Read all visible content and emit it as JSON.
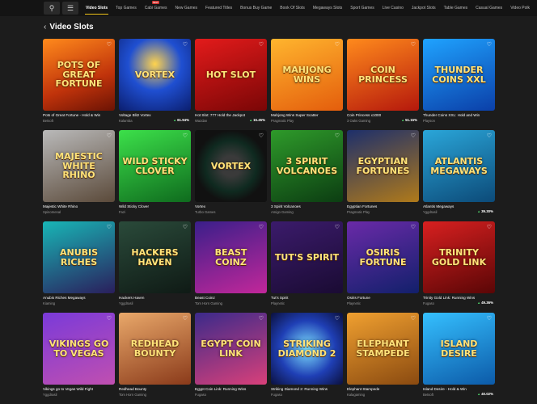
{
  "topbar": {
    "search_icon": "search-icon",
    "filter_icon": "filter-icon",
    "tabs": [
      {
        "label": "Video Slots",
        "active": true
      },
      {
        "label": "Top Games"
      },
      {
        "label": "Cabi Games",
        "badge": "NEW"
      },
      {
        "label": "New Games"
      },
      {
        "label": "Featured Titles"
      },
      {
        "label": "Bonus Buy Game"
      },
      {
        "label": "Book Of Slots"
      },
      {
        "label": "Megaways Slots"
      },
      {
        "label": "Sport Games"
      },
      {
        "label": "Live Casino"
      },
      {
        "label": "Jackpot Slots"
      },
      {
        "label": "Table Games"
      },
      {
        "label": "Casual Games"
      },
      {
        "label": "Video Polk"
      }
    ]
  },
  "header": {
    "back_icon": "chevron-left-icon",
    "title": "Video Slots"
  },
  "colors": {
    "page_bg": "#1c1c1c",
    "topbar_bg": "#141414",
    "accent": "#f0c419",
    "rtp_green": "#4fd46a"
  },
  "games": [
    {
      "art": "Pots of Great Fortune",
      "name": "Pots of Great Fortune - Hold & Win",
      "provider": "Betsoft",
      "rtp": "",
      "bg": "linear-gradient(160deg,#ff8a1c,#c0330b 60%,#6b1304)"
    },
    {
      "art": "Vortex",
      "name": "Voltage Blitz Vortex",
      "provider": "Kalamba",
      "rtp": "61.94%",
      "bg": "radial-gradient(circle at 50% 35%,#ffd34d,#1f4fd1 45%,#0b1e6e)"
    },
    {
      "art": "Hot Slot",
      "name": "Hot Slot: 777 Hold the Jackpot",
      "provider": "Wazdan",
      "rtp": "15.45%",
      "bg": "linear-gradient(160deg,#e31b1b,#7a0606)"
    },
    {
      "art": "Mahjong Wins",
      "name": "Mahjong Wins Super Scatter",
      "provider": "Pragmatic Play",
      "rtp": "",
      "bg": "linear-gradient(160deg,#ffb52e,#e45d0c)"
    },
    {
      "art": "Coin Princess",
      "name": "Coin Princess x1000",
      "provider": "3 Oaks Gaming",
      "rtp": "51.15%",
      "bg": "linear-gradient(160deg,#ff8a1c,#b5180c)"
    },
    {
      "art": "Thunder Coins XXL",
      "name": "Thunder Coins XXL: Hold and Win",
      "provider": "Playson",
      "rtp": "",
      "bg": "linear-gradient(160deg,#1fa3ff,#0b3fa8)"
    },
    {
      "art": "Majestic White Rhino",
      "name": "Majestic White Rhino",
      "provider": "Spinomenal",
      "rtp": "",
      "bg": "linear-gradient(160deg,#b9b9b9,#5b4a3a)"
    },
    {
      "art": "Wild Sticky Clover",
      "name": "Wild Sticky Clover",
      "provider": "Fazi",
      "rtp": "",
      "bg": "linear-gradient(160deg,#3ce04a,#0f6b1e)"
    },
    {
      "art": "Vortex",
      "name": "Vortex",
      "provider": "Turbo Games",
      "rtp": "",
      "bg": "radial-gradient(circle,#3a3a3a 20%,#0f2a20 50%,#111 70%)"
    },
    {
      "art": "3 Spirit Volcanoes",
      "name": "3 Spirit Volcanoes",
      "provider": "Amigo Gaming",
      "rtp": "",
      "bg": "linear-gradient(160deg,#2e9a2a,#0c3d12)"
    },
    {
      "art": "Egyptian Fortunes",
      "name": "Egyptian Fortunes",
      "provider": "Pragmatic Play",
      "rtp": "",
      "bg": "linear-gradient(160deg,#1d2f6b,#b07a1a)"
    },
    {
      "art": "Atlantis Megaways",
      "name": "Atlantis Megaways",
      "provider": "Yggdrasil",
      "rtp": "39.30%",
      "bg": "linear-gradient(160deg,#2aa6d9,#0c4a78)"
    },
    {
      "art": "Anubis Riches",
      "name": "Anubis Riches Megaways",
      "provider": "Kiaming",
      "rtp": "",
      "bg": "linear-gradient(160deg,#18b6b6,#2a1e5c)"
    },
    {
      "art": "Hackers Haven",
      "name": "Hackers Haven",
      "provider": "Yggdrasil",
      "rtp": "",
      "bg": "linear-gradient(160deg,#2a4a3a,#0f1a15)"
    },
    {
      "art": "Beast Coinz",
      "name": "Beast Coinz",
      "provider": "Tom Horn Gaming",
      "rtp": "",
      "bg": "linear-gradient(160deg,#3a1f8a,#c2279a)"
    },
    {
      "art": "Tut's Spirit",
      "name": "Tut's Spirit",
      "provider": "Playnetic",
      "rtp": "",
      "bg": "linear-gradient(160deg,#3b1b6b,#1a0b33)"
    },
    {
      "art": "Osiris Fortune",
      "name": "Osiris Fortune",
      "provider": "Playnetic",
      "rtp": "",
      "bg": "linear-gradient(160deg,#6a2aa8,#12206b)"
    },
    {
      "art": "Trinity Gold Link",
      "name": "Trinity Gold Link: Running Wins",
      "provider": "Fugaso",
      "rtp": "49.36%",
      "bg": "linear-gradient(160deg,#d82020,#5a0606)"
    },
    {
      "art": "Vikings Go to Vegas",
      "name": "Vikings go to Vegas Wild Fight",
      "provider": "Yggdrasil",
      "rtp": "",
      "bg": "linear-gradient(160deg,#7a3ad9,#c04fb0)"
    },
    {
      "art": "Redhead Bounty",
      "name": "Redhead Bounty",
      "provider": "Tom Horn Gaming",
      "rtp": "",
      "bg": "linear-gradient(160deg,#e9a86a,#8a3a1a)"
    },
    {
      "art": "Egypt Coin Link",
      "name": "Egypt Coin Link: Running Wins",
      "provider": "Fugaso",
      "rtp": "",
      "bg": "linear-gradient(160deg,#3b2a8a,#d9407a)"
    },
    {
      "art": "Striking Diamond 2",
      "name": "Striking Diamond 2: Running Wins",
      "provider": "Fugaso",
      "rtp": "",
      "bg": "radial-gradient(circle,#7fe3ff,#1f3fb5 55%,#0b103d)"
    },
    {
      "art": "Elephant Stampede",
      "name": "Elephant Stampede",
      "provider": "Kalagaming",
      "rtp": "",
      "bg": "linear-gradient(160deg,#f0a030,#8a4a10)"
    },
    {
      "art": "Island Desire",
      "name": "Island Desire - Hold & Win",
      "provider": "Betsoft",
      "rtp": "40.02%",
      "bg": "linear-gradient(160deg,#35c0ff,#0c5aa8)"
    }
  ]
}
